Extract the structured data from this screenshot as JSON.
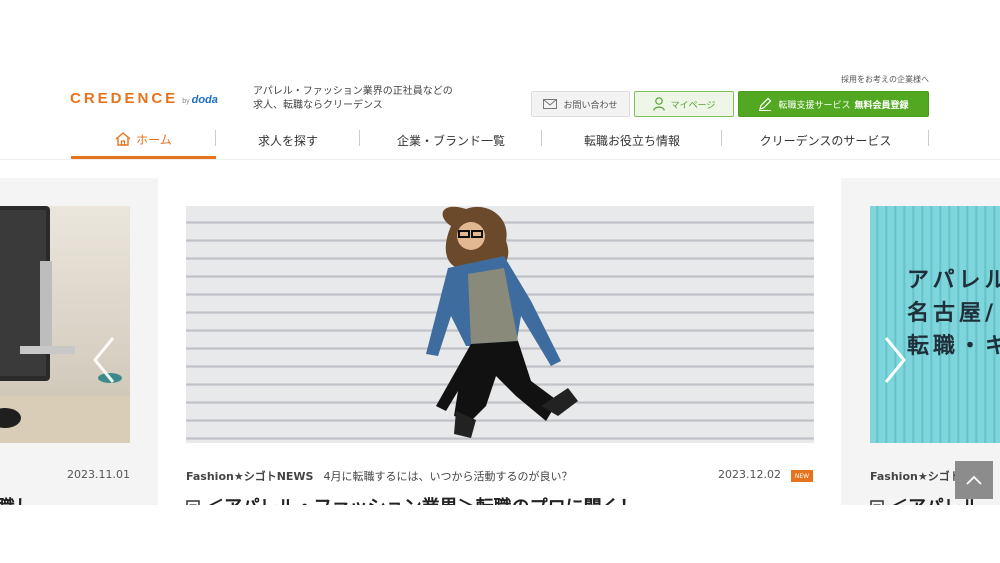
{
  "header": {
    "logo_text": "CREDENCE",
    "logo_by": "by",
    "logo_partner": "doda",
    "tagline": "アパレル・ファッション業界の正社員などの求人、転職ならクリーデンス",
    "corporate_link": "採用をお考えの企業様へ",
    "contact_label": "お問い合わせ",
    "mypage_label": "マイページ",
    "register_label": "転職支援サービス",
    "register_strong": "無料会員登録"
  },
  "nav": {
    "items": [
      {
        "label": "ホーム",
        "active": true
      },
      {
        "label": "求人を探す"
      },
      {
        "label": "企業・ブランド一覧"
      },
      {
        "label": "転職お役立ち情報"
      },
      {
        "label": "クリーデンスのサービス"
      }
    ]
  },
  "carousel": {
    "left": {
      "date": "2023.11.01",
      "headline_fragment": "職し"
    },
    "center": {
      "category": "Fashion★シゴトNEWS",
      "subtitle": "4月に転職するには、いつから活動するのが良い？",
      "date": "2023.12.02",
      "badge": "NEW",
      "headline": "＜アパレル・ファッション業界＞転職のプロに聞く！"
    },
    "right": {
      "category": "Fashion★シゴト",
      "overlay_lines": [
        "アパレル",
        "名古屋/",
        "転職・キ"
      ],
      "headline": "＜アパレル"
    }
  },
  "colors": {
    "accent": "#e8731f",
    "brand_green": "#52a820",
    "partner_blue": "#1d6fc3"
  }
}
